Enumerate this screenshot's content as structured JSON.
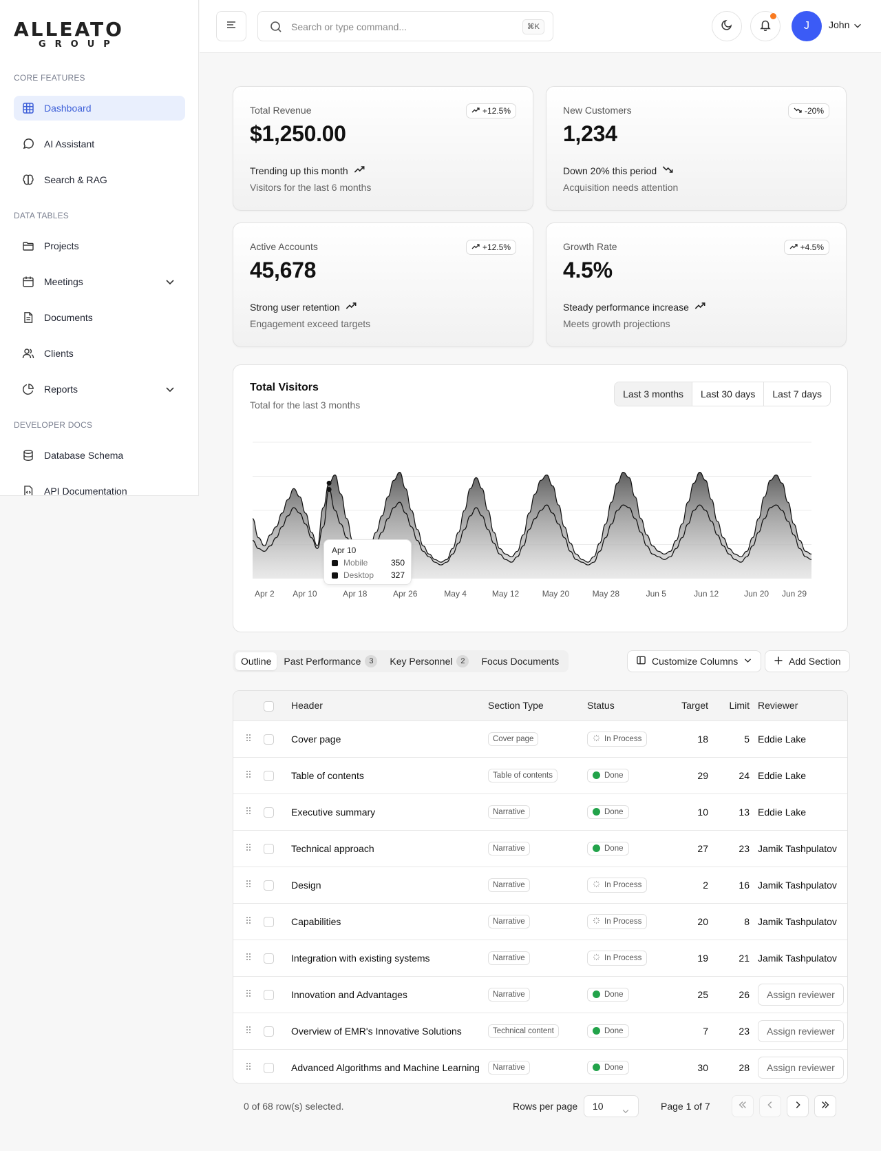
{
  "brand": {
    "line1": "ALLEATO",
    "line2": "GROUP"
  },
  "sidebar": {
    "sections": [
      {
        "title": "CORE FEATURES"
      },
      {
        "title": "DATA TABLES"
      },
      {
        "title": "DEVELOPER DOCS"
      }
    ],
    "items": [
      {
        "label": "Dashboard",
        "icon": "grid-icon",
        "active": true
      },
      {
        "label": "AI Assistant",
        "icon": "chat-bubble-icon"
      },
      {
        "label": "Search & RAG",
        "icon": "brain-icon"
      },
      {
        "label": "Projects",
        "icon": "folder-icon"
      },
      {
        "label": "Meetings",
        "icon": "calendar-icon",
        "expandable": true
      },
      {
        "label": "Documents",
        "icon": "document-icon"
      },
      {
        "label": "Clients",
        "icon": "users-icon"
      },
      {
        "label": "Reports",
        "icon": "pie-chart-icon",
        "expandable": true
      },
      {
        "label": "Database Schema",
        "icon": "database-icon"
      },
      {
        "label": "API Documentation",
        "icon": "code-file-icon"
      }
    ]
  },
  "topbar": {
    "search_placeholder": "Search or type command...",
    "search_shortcut": "⌘K",
    "avatar_initial": "J",
    "user_name": "John",
    "notification_dot_color": "#f97a1f",
    "avatar_color": "#3b5bf6"
  },
  "stats": [
    {
      "label": "Total Revenue",
      "value": "$1,250.00",
      "badge": "+12.5%",
      "direction": "up",
      "trend": "Trending up this month",
      "sub": "Visitors for the last 6 months"
    },
    {
      "label": "New Customers",
      "value": "1,234",
      "badge": "-20%",
      "direction": "down",
      "trend": "Down 20% this period",
      "sub": "Acquisition needs attention"
    },
    {
      "label": "Active Accounts",
      "value": "45,678",
      "badge": "+12.5%",
      "direction": "up",
      "trend": "Strong user retention",
      "sub": "Engagement exceed targets"
    },
    {
      "label": "Growth Rate",
      "value": "4.5%",
      "badge": "+4.5%",
      "direction": "up",
      "trend": "Steady performance increase",
      "sub": "Meets growth projections"
    }
  ],
  "visitors": {
    "title": "Total Visitors",
    "subtitle": "Total for the last 3 months",
    "ranges": [
      "Last 3 months",
      "Last 30 days",
      "Last 7 days"
    ],
    "selected_range": "Last 3 months",
    "tooltip": {
      "date": "Apr 10",
      "rows": [
        {
          "name": "Mobile",
          "value": "350"
        },
        {
          "name": "Desktop",
          "value": "327"
        }
      ]
    }
  },
  "chart_data": {
    "type": "area",
    "x_ticks": [
      "Apr 2",
      "Apr 10",
      "Apr 18",
      "Apr 26",
      "May 4",
      "May 12",
      "May 20",
      "May 28",
      "Jun 5",
      "Jun 12",
      "Jun 20",
      "Jun 29"
    ],
    "grid": true,
    "legend": "none",
    "ylim": [
      0,
      500
    ],
    "series": [
      {
        "name": "Mobile",
        "values": [
          220,
          150,
          120,
          160,
          190,
          240,
          290,
          330,
          300,
          240,
          170,
          120,
          260,
          350,
          380,
          310,
          220,
          140,
          90,
          80,
          120,
          170,
          230,
          300,
          360,
          390,
          330,
          250,
          180,
          120,
          90,
          70,
          60,
          70,
          110,
          170,
          250,
          330,
          370,
          330,
          250,
          170,
          110,
          90,
          80,
          100,
          160,
          240,
          310,
          360,
          380,
          340,
          270,
          190,
          130,
          90,
          70,
          60,
          80,
          130,
          200,
          280,
          350,
          390,
          370,
          300,
          220,
          160,
          120,
          100,
          90,
          100,
          140,
          200,
          280,
          350,
          390,
          360,
          290,
          210,
          150,
          110,
          90,
          80,
          100,
          150,
          220,
          300,
          360,
          380,
          350,
          280,
          200,
          140,
          100,
          90
        ]
      },
      {
        "name": "Desktop",
        "values": [
          140,
          110,
          100,
          120,
          150,
          190,
          230,
          260,
          240,
          200,
          150,
          110,
          190,
          327,
          250,
          200,
          150,
          110,
          80,
          70,
          90,
          130,
          170,
          220,
          260,
          280,
          240,
          190,
          140,
          100,
          80,
          60,
          50,
          60,
          90,
          130,
          180,
          230,
          260,
          230,
          180,
          130,
          90,
          70,
          60,
          80,
          120,
          180,
          220,
          250,
          270,
          240,
          200,
          150,
          100,
          70,
          60,
          50,
          60,
          100,
          150,
          200,
          250,
          270,
          260,
          220,
          170,
          120,
          90,
          80,
          70,
          80,
          110,
          150,
          200,
          250,
          270,
          250,
          210,
          160,
          120,
          90,
          70,
          60,
          80,
          120,
          170,
          220,
          260,
          270,
          250,
          210,
          160,
          110,
          80,
          70
        ]
      }
    ]
  },
  "tabs": [
    {
      "label": "Outline",
      "active": true
    },
    {
      "label": "Past Performance",
      "count": "3"
    },
    {
      "label": "Key Personnel",
      "count": "2"
    },
    {
      "label": "Focus Documents"
    }
  ],
  "actions": {
    "customize": "Customize Columns",
    "add_section": "Add Section"
  },
  "table": {
    "columns": [
      "Header",
      "Section Type",
      "Status",
      "Target",
      "Limit",
      "Reviewer"
    ],
    "rows": [
      {
        "header": "Cover page",
        "type": "Cover page",
        "status": "In Process",
        "target": "18",
        "limit": "5",
        "reviewer": "Eddie Lake"
      },
      {
        "header": "Table of contents",
        "type": "Table of contents",
        "status": "Done",
        "target": "29",
        "limit": "24",
        "reviewer": "Eddie Lake"
      },
      {
        "header": "Executive summary",
        "type": "Narrative",
        "status": "Done",
        "target": "10",
        "limit": "13",
        "reviewer": "Eddie Lake"
      },
      {
        "header": "Technical approach",
        "type": "Narrative",
        "status": "Done",
        "target": "27",
        "limit": "23",
        "reviewer": "Jamik Tashpulatov"
      },
      {
        "header": "Design",
        "type": "Narrative",
        "status": "In Process",
        "target": "2",
        "limit": "16",
        "reviewer": "Jamik Tashpulatov"
      },
      {
        "header": "Capabilities",
        "type": "Narrative",
        "status": "In Process",
        "target": "20",
        "limit": "8",
        "reviewer": "Jamik Tashpulatov"
      },
      {
        "header": "Integration with existing systems",
        "type": "Narrative",
        "status": "In Process",
        "target": "19",
        "limit": "21",
        "reviewer": "Jamik Tashpulatov"
      },
      {
        "header": "Innovation and Advantages",
        "type": "Narrative",
        "status": "Done",
        "target": "25",
        "limit": "26",
        "reviewer": "Assign reviewer"
      },
      {
        "header": "Overview of EMR's Innovative Solutions",
        "type": "Technical content",
        "status": "Done",
        "target": "7",
        "limit": "23",
        "reviewer": "Assign reviewer"
      },
      {
        "header": "Advanced Algorithms and Machine Learning",
        "type": "Narrative",
        "status": "Done",
        "target": "30",
        "limit": "28",
        "reviewer": "Assign reviewer"
      }
    ]
  },
  "footer": {
    "selected": "0 of 68 row(s) selected.",
    "rows_per_page_label": "Rows per page",
    "rows_per_page": "10",
    "page": "Page 1 of 7"
  }
}
